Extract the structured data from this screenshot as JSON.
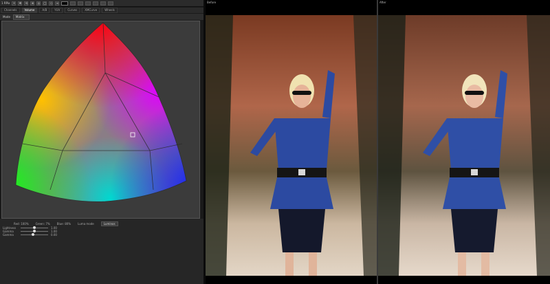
{
  "toolbar": {
    "label": "1 RPix"
  },
  "tabs": [
    {
      "label": "Channels"
    },
    {
      "label": "Volume"
    },
    {
      "label": "A/B"
    },
    {
      "label": "YUV"
    },
    {
      "label": "Curves"
    },
    {
      "label": "XMCurve"
    },
    {
      "label": "Wheels"
    }
  ],
  "modebar": {
    "mode_label": "Mode",
    "mode_value": "Matrix"
  },
  "readouts": {
    "red": "Red: 100%",
    "green": "Green: 7%",
    "blue": "Blue: 80%",
    "luma_mode_label": "Luma mode",
    "luma_mode_value": "Luminos"
  },
  "sliders": [
    {
      "name": "Lightness",
      "value": "1.00",
      "level": 0.5
    },
    {
      "name": "Gamma",
      "value": "1.00",
      "level": 0.5
    },
    {
      "name": "Gamma",
      "value": "0.00",
      "level": 0.45
    }
  ],
  "before_panel": {
    "caption": "Before"
  },
  "after_panel": {
    "caption": "After"
  },
  "colors": {
    "before_background": "#8b4a2a",
    "after_background": "#8a4b32",
    "dress": "#2c4aa1"
  }
}
